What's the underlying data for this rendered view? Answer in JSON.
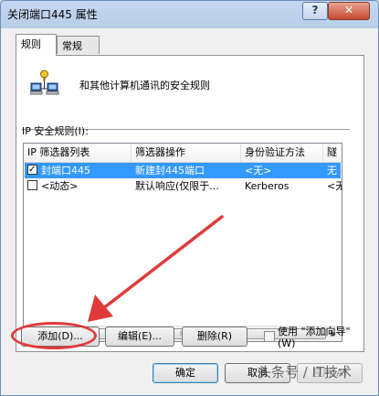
{
  "window": {
    "title": "关闭端口445 属性",
    "help_label": "?",
    "close_label": "✕"
  },
  "tabs": [
    {
      "label": "规则",
      "active": true
    },
    {
      "label": "常规",
      "active": false
    }
  ],
  "header": {
    "description": "和其他计算机通讯的安全规则",
    "icon": "network-computers-icon"
  },
  "rules": {
    "label": "IP 安全规则(I):",
    "columns": [
      "IP 筛选器列表",
      "筛选器操作",
      "身份验证方法",
      "隧"
    ],
    "rows": [
      {
        "checked": true,
        "selected": true,
        "filter_list": "封端口445",
        "action": "新建封445端口",
        "auth": "<无>",
        "tunnel": "无"
      },
      {
        "checked": false,
        "selected": false,
        "filter_list": "<动态>",
        "action": "默认响应(仅限于...",
        "auth": "Kerberos",
        "tunnel": "<无"
      }
    ],
    "scroll_thumb_grip": "III"
  },
  "buttons": {
    "add": "添加(D)...",
    "edit": "编辑(E)...",
    "remove": "删除(R)",
    "use_wizard": "使用 \"添加向导\"(W)"
  },
  "footer": {
    "ok": "确定",
    "cancel": "取消",
    "apply": "应用(A)"
  },
  "watermark": "头条号 / IT技术",
  "colors": {
    "selection": "#3399ff",
    "annotation_red": "#e03a3a"
  }
}
